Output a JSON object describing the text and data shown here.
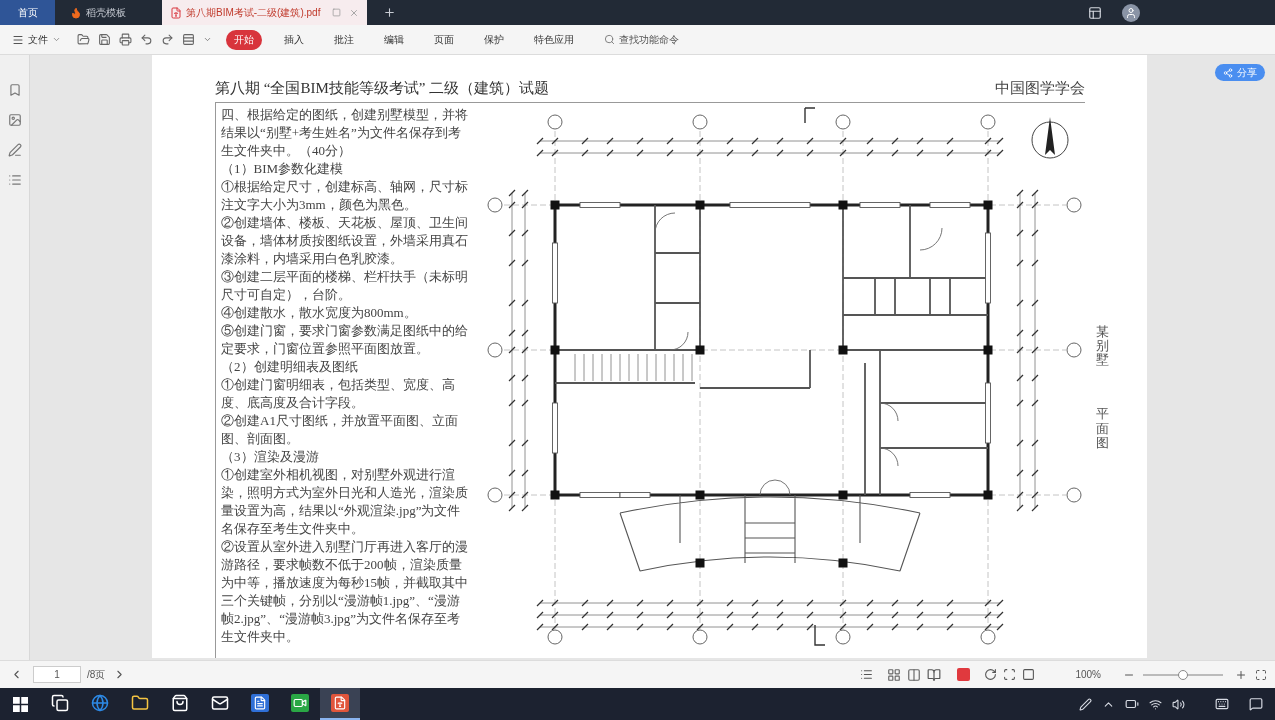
{
  "title_bar": {
    "tabs": [
      {
        "kind": "home",
        "label": "首页",
        "selected": false
      },
      {
        "kind": "template",
        "label": "稻壳模板",
        "selected": false
      },
      {
        "kind": "pdf",
        "label": "第八期BIM考试-二级(建筑).pdf",
        "selected": true
      }
    ]
  },
  "toolbar": {
    "file_menu": "文件",
    "tabs": [
      {
        "label": "开始",
        "selected": true
      },
      {
        "label": "插入",
        "selected": false
      },
      {
        "label": "批注",
        "selected": false
      },
      {
        "label": "编辑",
        "selected": false
      },
      {
        "label": "页面",
        "selected": false
      },
      {
        "label": "保护",
        "selected": false
      },
      {
        "label": "特色应用",
        "selected": false
      }
    ],
    "search": {
      "placeholder": "查找功能命令"
    }
  },
  "share_button": "分享",
  "document": {
    "header_title": "第八期 “全国BIM技能等级考试” 二级（建筑）试题",
    "header_org": "中国图学学会",
    "question_text": [
      "四、根据给定的图纸，创建别墅模型，并将结果以“别墅+考生姓名”为文件名保存到考生文件夹中。（40分）",
      "（1）BIM参数化建模",
      "①根据给定尺寸，创建标高、轴网，尺寸标注文字大小为3mm，颜色为黑色。",
      "②创建墙体、楼板、天花板、屋顶、卫生间设备，墙体材质按图纸设置，外墙采用真石漆涂料，内墙采用白色乳胶漆。",
      "③创建二层平面的楼梯、栏杆扶手（未标明尺寸可自定），台阶。",
      "④创建散水，散水宽度为800mm。",
      "⑤创建门窗，要求门窗参数满足图纸中的给定要求，门窗位置参照平面图放置。",
      "（2）创建明细表及图纸",
      "①创建门窗明细表，包括类型、宽度、高度、底高度及合计字段。",
      "②创建A1尺寸图纸，并放置平面图、立面图、剖面图。",
      "（3）渲染及漫游",
      "①创建室外相机视图，对别墅外观进行渲染，照明方式为室外日光和人造光，渲染质量设置为高，结果以“外观渲染.jpg”为文件名保存至考生文件夹中。",
      "②设置从室外进入别墅门厅再进入客厅的漫游路径，要求帧数不低于200帧，渲染质量为中等，播放速度为每秒15帧，并截取其中三个关键帧，分别以“漫游帧1.jpg”、“漫游帧2.jpg”、“漫游帧3.jpg”为文件名保存至考生文件夹中。"
    ],
    "plan_side_labels": [
      "某别墅",
      "平面图"
    ]
  },
  "status_bar": {
    "page_input": "1",
    "page_count": "/8页",
    "zoom": "100%",
    "zoom_slider": {
      "level": 0.5
    }
  },
  "taskbar": {
    "apps": [
      {
        "kind": "taskview",
        "selected": false
      },
      {
        "kind": "browser",
        "selected": false
      },
      {
        "kind": "folder",
        "selected": false
      },
      {
        "kind": "store",
        "selected": false
      },
      {
        "kind": "mail",
        "selected": false
      },
      {
        "kind": "docs",
        "selected": false
      },
      {
        "kind": "recorder",
        "selected": false
      },
      {
        "kind": "pdf",
        "selected": true
      }
    ]
  }
}
